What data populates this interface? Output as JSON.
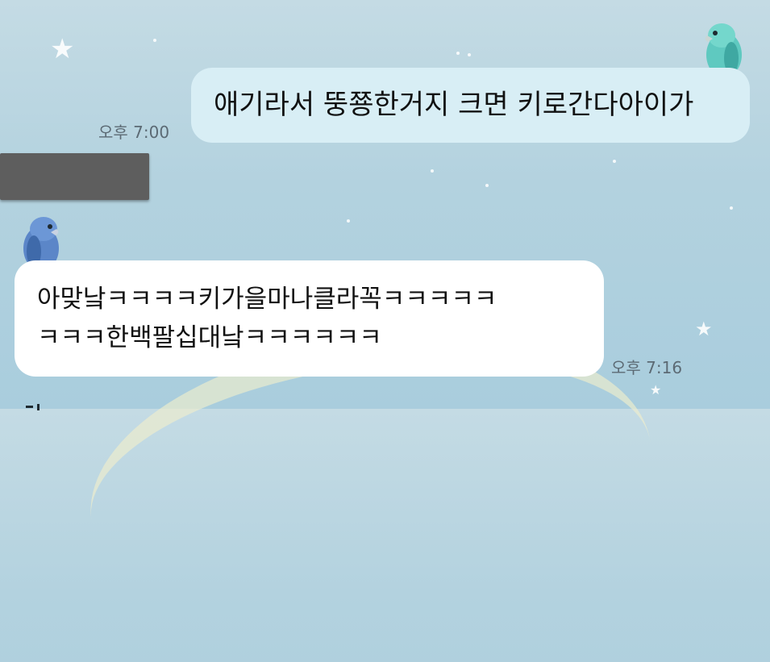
{
  "chat": {
    "messages": [
      {
        "direction": "outgoing",
        "lines": [
          "애기라서 뚱쭁한거지 크면 키로간다아이가"
        ],
        "time": "오후 7:00"
      },
      {
        "direction": "incoming",
        "lines": [
          "아맞낰ㅋㅋㅋㅋ키가을마나클라꼭ㅋㅋㅋㅋㅋ",
          "ㅋㅋㅋ한백팔십대낰ㅋㅋㅋㅋㅋㅋ"
        ],
        "time": "오후 7:16"
      }
    ],
    "avatars": {
      "outgoing": "teal-parrot-icon",
      "incoming": "blue-parrot-icon"
    }
  },
  "colors": {
    "background": "#b3d2df",
    "outgoing_bubble": "#d8eef5",
    "incoming_bubble": "#ffffff",
    "timestamp": "#5c6a74"
  }
}
